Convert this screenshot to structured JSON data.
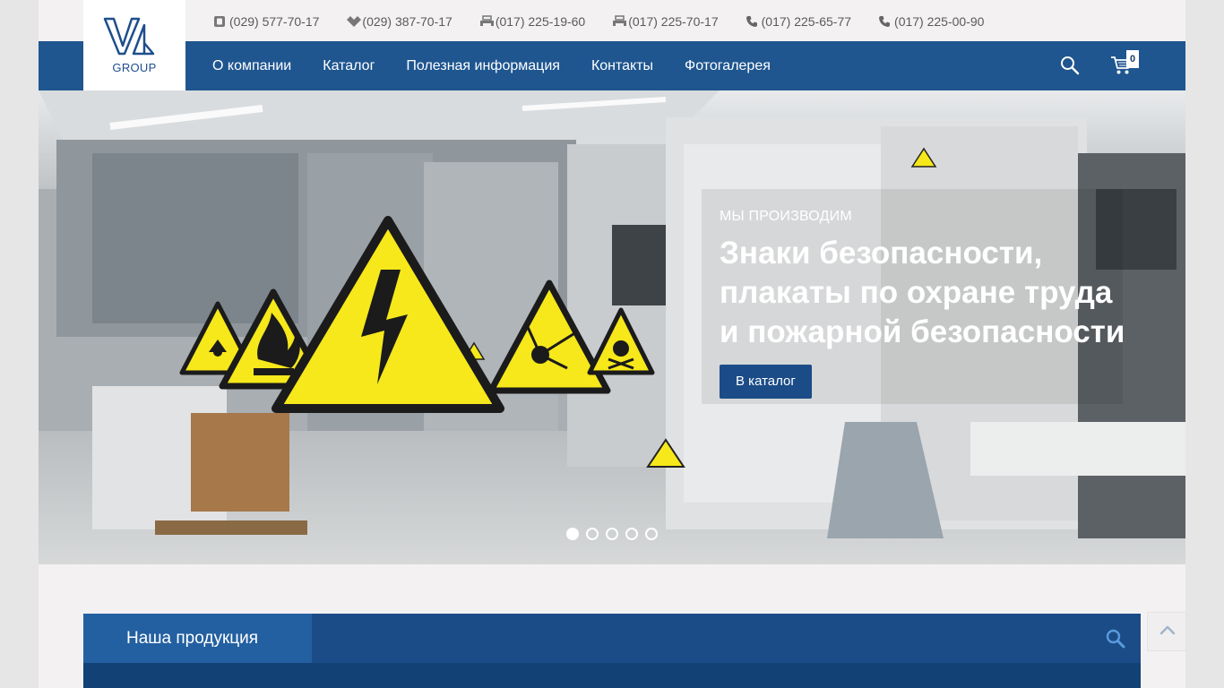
{
  "logo": {
    "text": "GROUP"
  },
  "contacts": [
    {
      "icon": "a1-mobile-icon",
      "number": "(029) 577-70-17"
    },
    {
      "icon": "mts-mobile-icon",
      "number": "(029) 387-70-17"
    },
    {
      "icon": "fax-icon",
      "number": "(017) 225-19-60"
    },
    {
      "icon": "fax-icon",
      "number": "(017) 225-70-17"
    },
    {
      "icon": "phone-icon",
      "number": "(017) 225-65-77"
    },
    {
      "icon": "phone-icon",
      "number": "(017) 225-00-90"
    }
  ],
  "nav": {
    "items": [
      "О компании",
      "Каталог",
      "Полезная информация",
      "Контакты",
      "Фотогалерея"
    ],
    "cart_count": "0"
  },
  "hero": {
    "subtitle": "Мы производим",
    "title_lines": [
      "Знаки безопасности,",
      "плакаты по охране труда",
      "и пожарной безопасности"
    ],
    "button": "В каталог",
    "slides_total": 5,
    "active_slide": 1
  },
  "products": {
    "tab_label": "Наша продукция"
  },
  "colors": {
    "nav_bg": "#1f5690",
    "accent": "#1b4c87",
    "warning_yellow": "#f6e81a"
  }
}
